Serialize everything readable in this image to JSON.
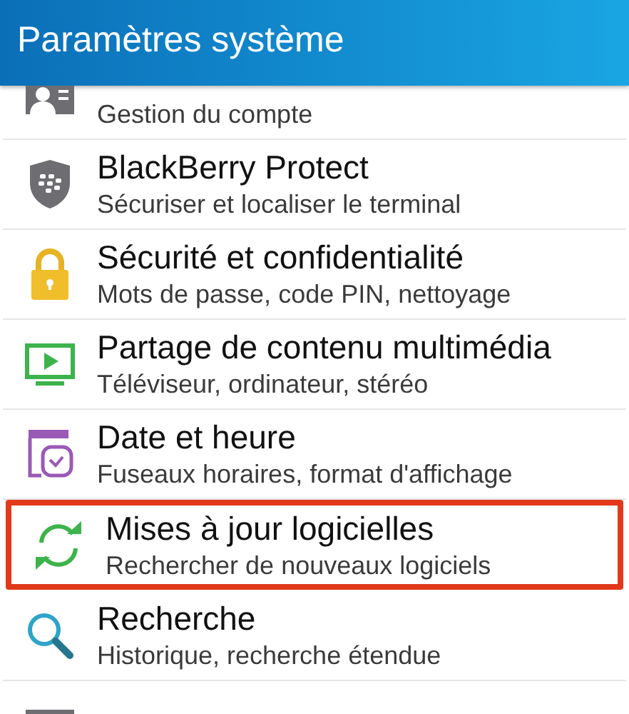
{
  "header": {
    "title": "Paramètres système"
  },
  "items": [
    {
      "subtitle": "Gestion du compte",
      "highlighted": false
    },
    {
      "title": "BlackBerry Protect",
      "subtitle": "Sécuriser et localiser le terminal",
      "highlighted": false
    },
    {
      "title": "Sécurité et confidentialité",
      "subtitle": "Mots de passe, code PIN, nettoyage",
      "highlighted": false
    },
    {
      "title": "Partage de contenu multimédia",
      "subtitle": "Téléviseur, ordinateur, stéréo",
      "highlighted": false
    },
    {
      "title": "Date et heure",
      "subtitle": "Fuseaux horaires, format d'affichage",
      "highlighted": false
    },
    {
      "title": "Mises à jour logicielles",
      "subtitle": "Rechercher de nouveaux logiciels",
      "highlighted": true
    },
    {
      "title": "Recherche",
      "subtitle": "Historique, recherche étendue",
      "highlighted": false
    }
  ]
}
